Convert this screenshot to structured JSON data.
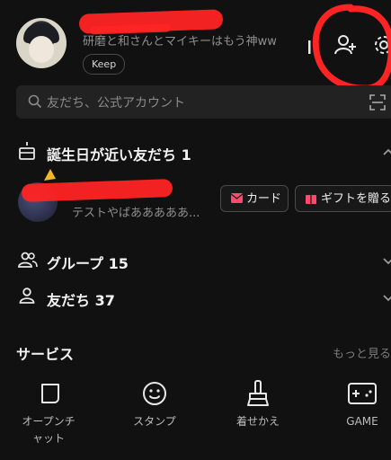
{
  "profile": {
    "status_message": "研磨と和さんとマイキーはもう神ww",
    "keep_label": "Keep"
  },
  "search": {
    "placeholder": "友だち、公式アカウント"
  },
  "birthday_section": {
    "title": "誕生日が近い友だち 1",
    "friend_message": "テストやばあああああ...",
    "card_button": "カード",
    "gift_button": "ギフトを贈る"
  },
  "groups": {
    "label": "グループ 15"
  },
  "friends": {
    "label": "友だち 37"
  },
  "services": {
    "title": "サービス",
    "more_label": "もっと見る",
    "items": [
      {
        "label": "オープンチ\nャット",
        "icon": "chat-bubble-icon"
      },
      {
        "label": "スタンプ",
        "icon": "smiley-icon"
      },
      {
        "label": "着せかえ",
        "icon": "brush-icon"
      },
      {
        "label": "GAME",
        "icon": "gamepad-icon"
      }
    ]
  },
  "colors": {
    "background": "#111111",
    "accent_red": "#ff2424",
    "icon_red": "#ff4a6e"
  }
}
